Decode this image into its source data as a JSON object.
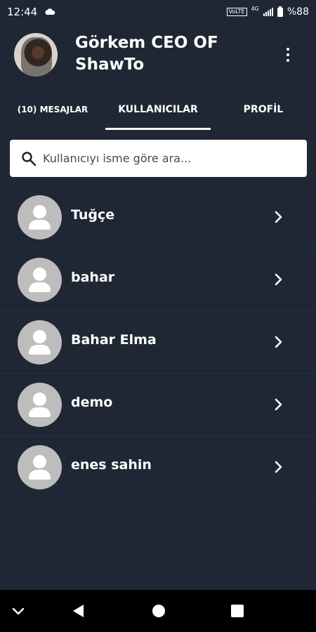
{
  "status_bar": {
    "time": "12:44",
    "volte": "VoLTE",
    "network": "4G",
    "battery": "%88"
  },
  "header": {
    "title": "Görkem CEO OF ShawTo",
    "menu_icon": "more-vert-icon"
  },
  "tabs": [
    {
      "label": "(10) MESAJLAR",
      "active": false
    },
    {
      "label": "KULLANICILAR",
      "active": true
    },
    {
      "label": "PROFİL",
      "active": false
    }
  ],
  "search": {
    "placeholder": "Kullanıcıyı isme göre ara...",
    "value": ""
  },
  "users": [
    {
      "name": "Tuğçe"
    },
    {
      "name": "bahar"
    },
    {
      "name": "Bahar Elma"
    },
    {
      "name": "demo"
    },
    {
      "name": "enes sahin"
    }
  ],
  "colors": {
    "background": "#1f2734",
    "avatar_placeholder": "#bdbdbd",
    "nav_bar": "#000000"
  }
}
